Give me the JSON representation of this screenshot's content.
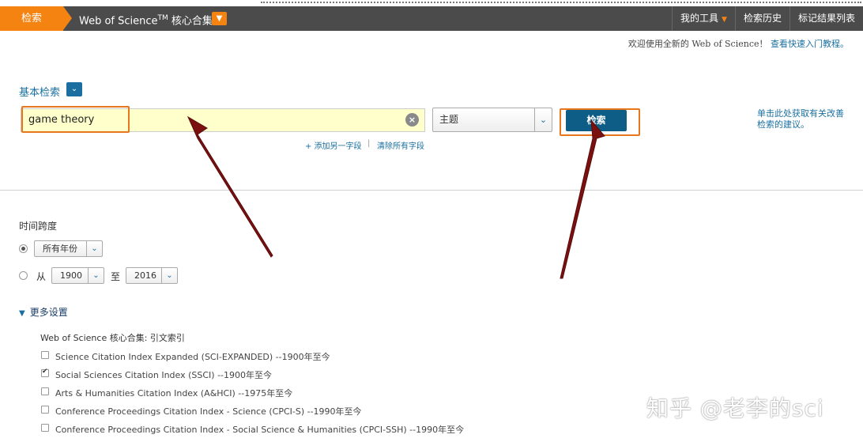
{
  "topbar": {
    "search_tab": "检索",
    "db_title": "Web of Science",
    "db_title_sup": "TM",
    "db_title_suffix": " 核心合集",
    "nav_items": [
      "我的工具",
      "检索历史",
      "标记结果列表"
    ]
  },
  "welcome": {
    "text": "欢迎使用全新的 Web of Science！",
    "link": "查看快速入门教程。"
  },
  "basic_search": {
    "label": "基本检索",
    "input_value": "game theory",
    "field_selected": "主题",
    "button_label": "检索",
    "help_text": "单击此处获取有关改善检索的建议。",
    "add_field": "+ 添加另一字段",
    "separator": "|",
    "clear_fields": "清除所有字段"
  },
  "timespan": {
    "label": "时间跨度",
    "all_years": "所有年份",
    "from_label": "从",
    "from_year": "1900",
    "to_label": "至",
    "to_year": "2016"
  },
  "more_settings": {
    "label": "更多设置",
    "heading": "Web of Science 核心合集: 引文索引",
    "indexes": [
      {
        "label": "Science Citation Index Expanded (SCI-EXPANDED) --1900年至今",
        "checked": false
      },
      {
        "label": "Social Sciences Citation Index (SSCI) --1900年至今",
        "checked": true
      },
      {
        "label": "Arts & Humanities Citation Index (A&HCI) --1975年至今",
        "checked": false
      },
      {
        "label": "Conference Proceedings Citation Index - Science (CPCI-S) --1990年至今",
        "checked": false
      },
      {
        "label": "Conference Proceedings Citation Index - Social Science & Humanities (CPCI-SSH) --1990年至今",
        "checked": false
      }
    ]
  },
  "watermark": "知乎 @老李的sci",
  "colors": {
    "accent_orange": "#f48312",
    "nav_bg": "#4b4b4b",
    "link_blue": "#1a6fa0",
    "search_button": "#0e5d86",
    "annotation_arrow": "#7a1010",
    "input_bg": "#ffffcc"
  }
}
